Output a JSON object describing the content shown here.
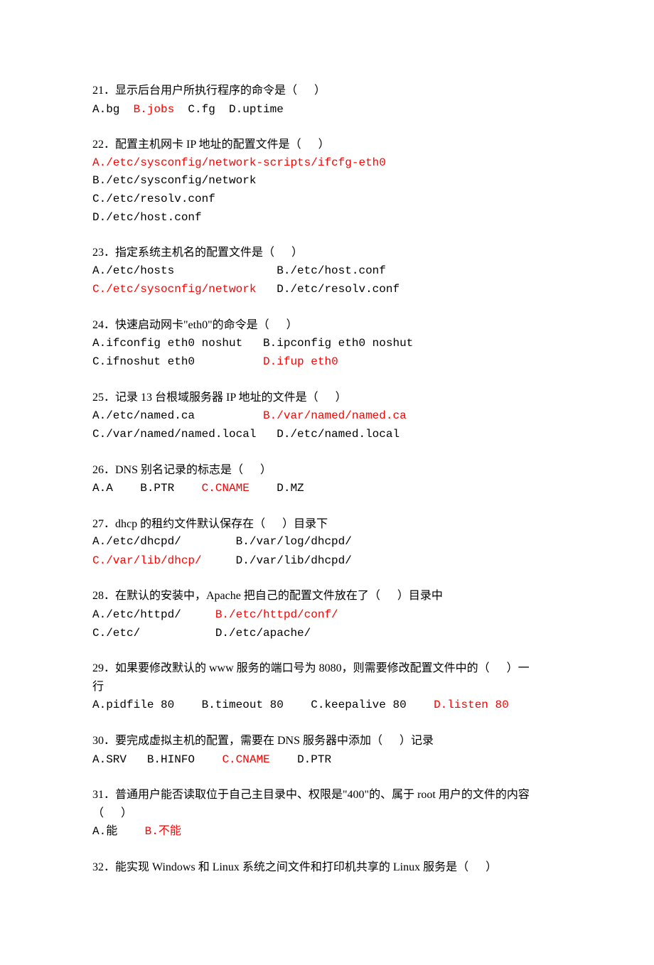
{
  "q21": {
    "stem": "21．显示后台用户所执行程序的命令是（      ）",
    "a": "A.bg  ",
    "b": "B.jobs",
    "c": "  C.fg  D.uptime"
  },
  "q22": {
    "stem": "22．配置主机网卡 IP 地址的配置文件是（      ）",
    "a": "A./etc/sysconfig/network-scripts/ifcfg-eth0",
    "b": "B./etc/sysconfig/network",
    "c": "C./etc/resolv.conf",
    "d": "D./etc/host.conf"
  },
  "q23": {
    "stem": "23．指定系统主机名的配置文件是（      ）",
    "row1": "A./etc/hosts               B./etc/host.conf",
    "c": "C./etc/sysocnfig/network",
    "d": "   D./etc/resolv.conf"
  },
  "q24": {
    "stem": "24．快速启动网卡\"eth0\"的命令是（      ）",
    "row1": "A.ifconfig eth0 noshut   B.ipconfig eth0 noshut",
    "c": "C.ifnoshut eth0          ",
    "d": "D.ifup eth0"
  },
  "q25": {
    "stem": "25．记录 13 台根域服务器 IP 地址的文件是（      ）",
    "a": "A./etc/named.ca          ",
    "b": "B./var/named/named.ca",
    "row2": "C./var/named/named.local   D./etc/named.local"
  },
  "q26": {
    "stem": "26．DNS 别名记录的标志是（      ）",
    "a": "A.A    B.PTR    ",
    "c": "C.CNAME",
    "d": "    D.MZ"
  },
  "q27": {
    "stem": "27．dhcp 的租约文件默认保存在（      ）目录下",
    "row1": "A./etc/dhcpd/        B./var/log/dhcpd/",
    "c": "C./var/lib/dhcp/",
    "d": "     D./var/lib/dhcpd/"
  },
  "q28": {
    "stem": "28．在默认的安装中，Apache 把自己的配置文件放在了（      ）目录中",
    "a": "A./etc/httpd/     ",
    "b": "B./etc/httpd/conf/",
    "row2": "C./etc/           D./etc/apache/"
  },
  "q29": {
    "stem1": "29．如果要修改默认的 www 服务的端口号为 8080，则需要修改配置文件中的（      ）一",
    "stem2": "行",
    "a": "A.pidfile 80    B.timeout 80    C.keepalive 80    ",
    "d": "D.listen 80"
  },
  "q30": {
    "stem": "30．要完成虚拟主机的配置，需要在 DNS 服务器中添加（      ）记录",
    "a": "A.SRV   B.HINFO    ",
    "c": "C.CNAME",
    "d": "    D.PTR"
  },
  "q31": {
    "stem1": "31．普通用户能否读取位于自己主目录中、权限是\"400\"的、属于 root 用户的文件的内容",
    "stem2": "（      ）",
    "a": "A.能    ",
    "b": "B.不能"
  },
  "q32": {
    "stem": "32．能实现 Windows 和 Linux 系统之间文件和打印机共享的 Linux 服务是（      ）"
  }
}
